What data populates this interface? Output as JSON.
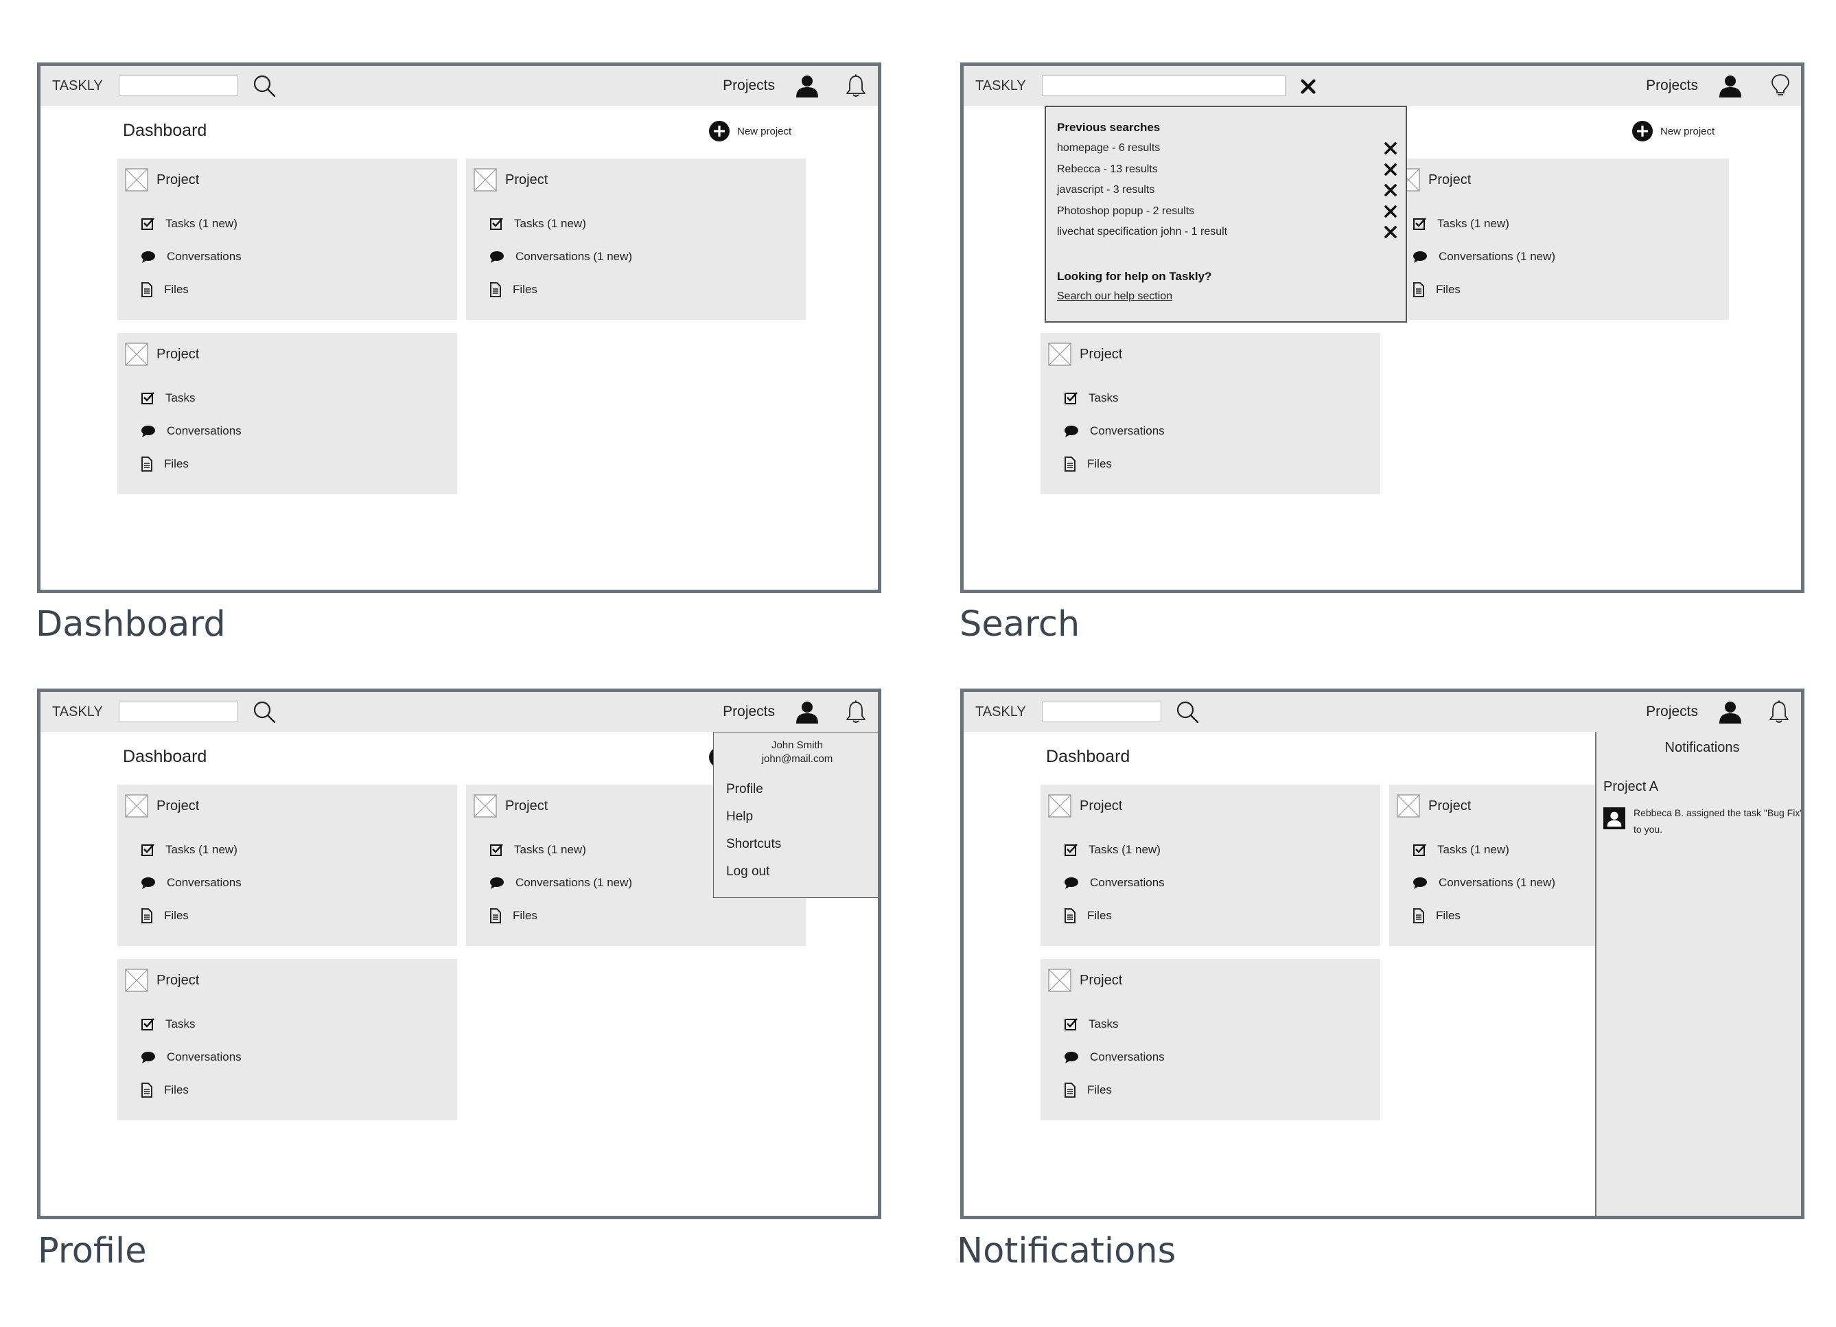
{
  "app": {
    "logo": "TASKLY",
    "projects_label": "Projects",
    "dashboard_title": "Dashboard",
    "new_project_label": "New project",
    "project_title": "Project",
    "items": {
      "tasks_new": "Tasks (1 new)",
      "tasks": "Tasks",
      "conversations": "Conversations",
      "conversations_new": "Conversations (1 new)",
      "files": "Files"
    }
  },
  "panels": [
    {
      "caption": "Dashboard"
    },
    {
      "caption": "Search"
    },
    {
      "caption": "Profile"
    },
    {
      "caption": "Notifications"
    }
  ],
  "search": {
    "previous_heading": "Previous searches",
    "previous": [
      "homepage - 6 results",
      "Rebecca - 13 results",
      "javascript - 3 results",
      "Photoshop popup - 2 results",
      "livechat specification john - 1 result"
    ],
    "help_heading": "Looking for help on Taskly?",
    "help_link": "Search our help section"
  },
  "profile_menu": {
    "name": "John Smith",
    "email": "john@mail.com",
    "items": [
      "Profile",
      "Help",
      "Shortcuts",
      "Log out"
    ]
  },
  "notifications": {
    "title": "Notifications",
    "project": "Project A",
    "message": "Rebbeca B. assigned the task \"Bug Fix\" to you."
  },
  "colors": {
    "panel_border": "#6b747c",
    "bar_grey": "#e9e9e9",
    "caption_text": "#3c4650"
  },
  "icons": [
    "search-icon",
    "close-icon",
    "user-icon",
    "bell-icon",
    "lightbulb-icon",
    "plus-circle-icon",
    "image-placeholder-icon",
    "checkbox-icon",
    "speech-bubble-icon",
    "file-icon",
    "avatar-icon"
  ]
}
